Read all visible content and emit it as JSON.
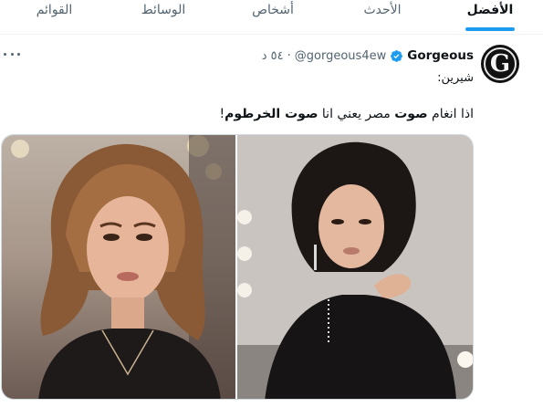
{
  "tabs": [
    {
      "label": "الأفضل",
      "active": true
    },
    {
      "label": "الأحدث",
      "active": false
    },
    {
      "label": "أشخاص",
      "active": false
    },
    {
      "label": "الوسائط",
      "active": false
    },
    {
      "label": "القوائم",
      "active": false
    }
  ],
  "tweet": {
    "avatar_letter": "G",
    "display_name": "Gorgeous",
    "handle": "@gorgeous4ew",
    "separator": "·",
    "time": "٥٤ د",
    "line1": "شيرين:",
    "line2_parts": {
      "p1": "اذا انغام ",
      "b1": "صوت",
      "p2": " مصر يعني انا ",
      "b2": "صوت الخرطوم",
      "p3": "!"
    }
  },
  "colors": {
    "accent": "#1d9bf0",
    "text_primary": "#0f1419",
    "text_secondary": "#536471",
    "border": "#eff3f4"
  },
  "icons": {
    "verified": "verified-badge-icon",
    "more": "more-horizontal-icon"
  }
}
